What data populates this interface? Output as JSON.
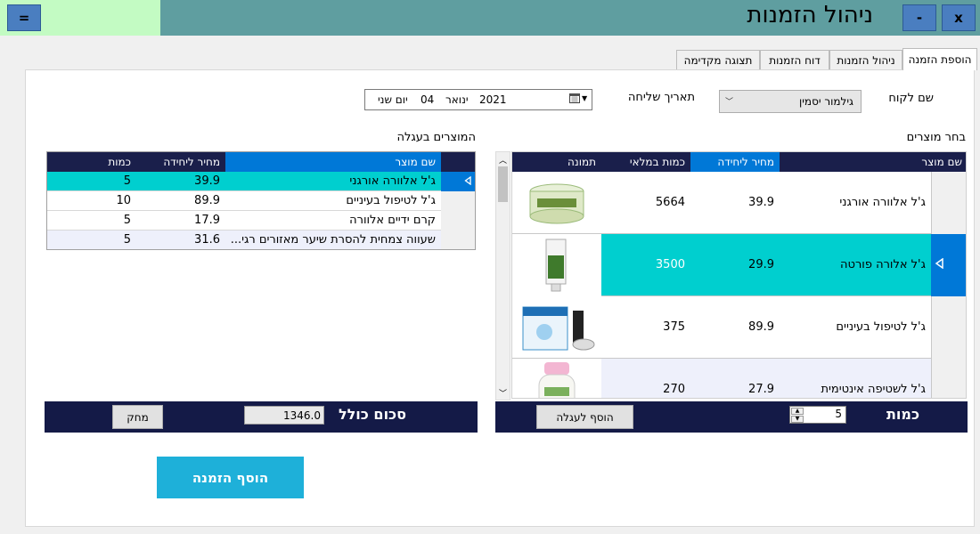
{
  "window": {
    "title": "ניהול הזמנות",
    "menu_btn": "=",
    "close_btn": "x",
    "minimize_btn": "-"
  },
  "tabs": [
    {
      "label": "הוספת הזמנה",
      "active": true
    },
    {
      "label": "ניהול הזמנות",
      "active": false
    },
    {
      "label": "דוח הזמנות",
      "active": false
    },
    {
      "label": "תצוגה מקדימה",
      "active": false
    }
  ],
  "form": {
    "customer_label": "שם לקוח",
    "customer_value": "גילמור יסמין",
    "date_label": "תאריך שליחה",
    "date_day_name": "יום שני",
    "date_day": "04",
    "date_month": "ינואר",
    "date_year": "2021"
  },
  "products": {
    "section_label": "בחר מוצרים",
    "headers": {
      "name": "שם מוצר",
      "price": "מחיר ליחידה",
      "stock": "כמות במלאי",
      "image": "תמונה"
    },
    "rows": [
      {
        "name": "ג'ל אלוורה אורגני",
        "price": "39.9",
        "stock": "5664",
        "image": "jar-image",
        "selected": false
      },
      {
        "name": "ג'ל אלורה פורטה",
        "price": "29.9",
        "stock": "3500",
        "image": "tube-image",
        "selected": true
      },
      {
        "name": "ג'ל לטיפול בעיניים",
        "price": "89.9",
        "stock": "375",
        "image": "box-image",
        "selected": false
      },
      {
        "name": "ג'ל לשטיפה אינטימית",
        "price": "27.9",
        "stock": "270",
        "image": "bottle-image",
        "selected": false
      }
    ],
    "quantity_label": "כמות",
    "quantity_value": "5",
    "add_to_cart_label": "הוסף לעגלה"
  },
  "cart": {
    "section_label": "המוצרים בעגלה",
    "headers": {
      "name": "שם מוצר",
      "price": "מחיר ליחידה",
      "qty": "כמות"
    },
    "rows": [
      {
        "name": "ג'ל אלוורה אורגני",
        "price": "39.9",
        "qty": "5",
        "selected": true
      },
      {
        "name": "ג'ל לטיפול בעיניים",
        "price": "89.9",
        "qty": "10",
        "selected": false
      },
      {
        "name": "קרם ידיים אלוורה",
        "price": "17.9",
        "qty": "5",
        "selected": false
      },
      {
        "name": "שעווה צמחית להסרת שיער מאזורים רגי...",
        "price": "31.6",
        "qty": "5",
        "selected": false
      }
    ],
    "total_label": "סכום כולל",
    "total_value": "1346.0",
    "delete_label": "מחק"
  },
  "add_order_label": "הוסף הזמנה",
  "colors": {
    "titlebar": "#5f9ea0",
    "header": "#1a1f4b",
    "selected_row": "#00cfcf",
    "accent": "#0078d7",
    "primary_button": "#1eb0d9"
  }
}
